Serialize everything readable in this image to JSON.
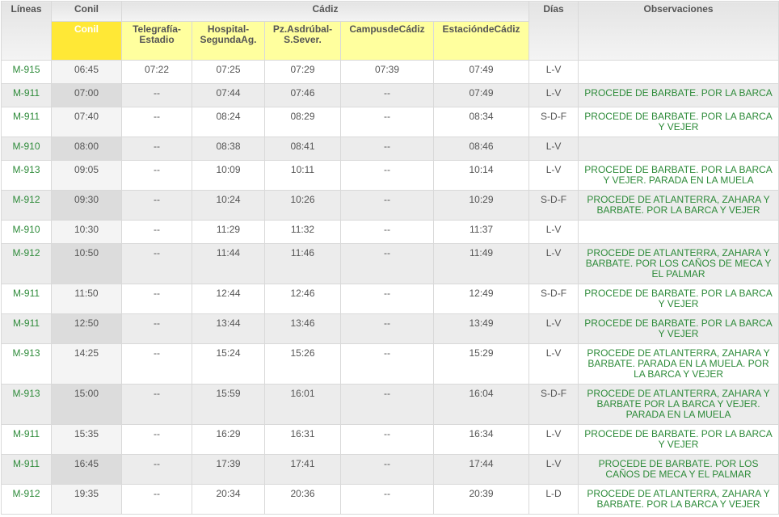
{
  "header": {
    "lineas": "Líneas",
    "conil_group": "Conil",
    "cadiz_group": "Cádiz",
    "dias": "Días",
    "observaciones": "Observaciones",
    "stops": [
      "Conil",
      "Telegrafía-Estadio",
      "Hospital-SegundaAg.",
      "Pz.Asdrúbal-S.Sever.",
      "CampusdeCádiz",
      "EstacióndeCádiz"
    ]
  },
  "rows": [
    {
      "linea": "M-915",
      "times": [
        "06:45",
        "07:22",
        "07:25",
        "07:29",
        "07:39",
        "07:49"
      ],
      "dias": "L-V",
      "obs": ""
    },
    {
      "linea": "M-911",
      "times": [
        "07:00",
        "--",
        "07:44",
        "07:46",
        "--",
        "07:49"
      ],
      "dias": "L-V",
      "obs": "PROCEDE DE BARBATE. POR LA BARCA"
    },
    {
      "linea": "M-911",
      "times": [
        "07:40",
        "--",
        "08:24",
        "08:29",
        "--",
        "08:34"
      ],
      "dias": "S-D-F",
      "obs": "PROCEDE DE BARBATE. POR LA BARCA Y VEJER"
    },
    {
      "linea": "M-910",
      "times": [
        "08:00",
        "--",
        "08:38",
        "08:41",
        "--",
        "08:46"
      ],
      "dias": "L-V",
      "obs": ""
    },
    {
      "linea": "M-913",
      "times": [
        "09:05",
        "--",
        "10:09",
        "10:11",
        "--",
        "10:14"
      ],
      "dias": "L-V",
      "obs": "PROCEDE DE BARBATE. POR LA BARCA Y VEJER. PARADA EN LA MUELA"
    },
    {
      "linea": "M-912",
      "times": [
        "09:30",
        "--",
        "10:24",
        "10:26",
        "--",
        "10:29"
      ],
      "dias": "S-D-F",
      "obs": "PROCEDE DE ATLANTERRA, ZAHARA Y BARBATE. POR LA BARCA Y VEJER"
    },
    {
      "linea": "M-910",
      "times": [
        "10:30",
        "--",
        "11:29",
        "11:32",
        "--",
        "11:37"
      ],
      "dias": "L-V",
      "obs": ""
    },
    {
      "linea": "M-912",
      "times": [
        "10:50",
        "--",
        "11:44",
        "11:46",
        "--",
        "11:49"
      ],
      "dias": "L-V",
      "obs": "PROCEDE DE ATLANTERRA, ZAHARA Y BARBATE. POR LOS CAÑOS DE MECA Y EL PALMAR"
    },
    {
      "linea": "M-911",
      "times": [
        "11:50",
        "--",
        "12:44",
        "12:46",
        "--",
        "12:49"
      ],
      "dias": "S-D-F",
      "obs": "PROCEDE DE BARBATE. POR LA BARCA Y VEJER"
    },
    {
      "linea": "M-911",
      "times": [
        "12:50",
        "--",
        "13:44",
        "13:46",
        "--",
        "13:49"
      ],
      "dias": "L-V",
      "obs": "PROCEDE DE BARBATE. POR LA BARCA Y VEJER"
    },
    {
      "linea": "M-913",
      "times": [
        "14:25",
        "--",
        "15:24",
        "15:26",
        "--",
        "15:29"
      ],
      "dias": "L-V",
      "obs": "PROCEDE DE ATLANTERRA, ZAHARA Y BARBATE. PARADA EN LA MUELA. POR LA BARCA Y VEJER"
    },
    {
      "linea": "M-913",
      "times": [
        "15:00",
        "--",
        "15:59",
        "16:01",
        "--",
        "16:04"
      ],
      "dias": "S-D-F",
      "obs": "PROCEDE DE ATLANTERRA, ZAHARA Y BARBATE POR LA BARCA Y VEJER. PARADA EN LA MUELA"
    },
    {
      "linea": "M-911",
      "times": [
        "15:35",
        "--",
        "16:29",
        "16:31",
        "--",
        "16:34"
      ],
      "dias": "L-V",
      "obs": "PROCEDE DE BARBATE. POR LA BARCA Y VEJER"
    },
    {
      "linea": "M-911",
      "times": [
        "16:45",
        "--",
        "17:39",
        "17:41",
        "--",
        "17:44"
      ],
      "dias": "L-V",
      "obs": "PROCEDE DE BARBATE. POR LOS CAÑOS DE MECA Y EL PALMAR"
    },
    {
      "linea": "M-912",
      "times": [
        "19:35",
        "--",
        "20:34",
        "20:36",
        "--",
        "20:39"
      ],
      "dias": "L-D",
      "obs": "PROCEDE DE ATLANTERRA, ZAHARA Y BARBATE. POR LA BARCA Y VEJER"
    }
  ]
}
